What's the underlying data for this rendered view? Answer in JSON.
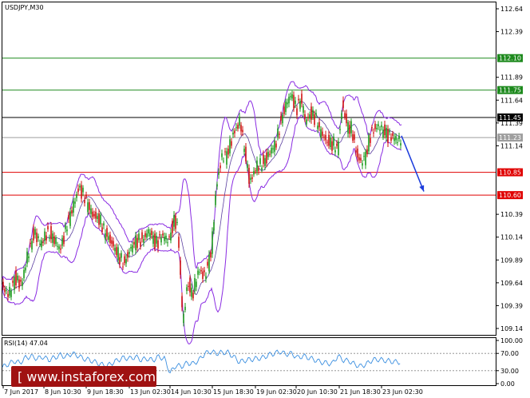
{
  "chart_data": {
    "type": "candlestick",
    "title": "USDJPY,M30",
    "price_axis": {
      "ticks": [
        112.64,
        112.39,
        111.89,
        111.64,
        111.39,
        111.14,
        110.39,
        110.14,
        109.89,
        109.64,
        109.39,
        109.14
      ],
      "ylim": [
        109.07,
        112.71
      ]
    },
    "x_labels": [
      "7 Jun 2017",
      "8 Jun 10:30",
      "9 Jun 18:30",
      "13 Jun 02:30",
      "14 Jun 10:30",
      "15 Jun 18:30",
      "19 Jun 02:30",
      "20 Jun 10:30",
      "21 Jun 18:30",
      "23 Jun 02:30"
    ],
    "levels": [
      {
        "value": 112.1,
        "label": "112.10",
        "color": "#1e8a1e"
      },
      {
        "value": 111.75,
        "label": "111.75",
        "color": "#1e8a1e"
      },
      {
        "value": 111.45,
        "label": "111.45",
        "color": "#000000"
      },
      {
        "value": 111.23,
        "label": "111.23",
        "color": "#9e9e9e"
      },
      {
        "value": 110.85,
        "label": "110.85",
        "color": "#e00000"
      },
      {
        "value": 110.6,
        "label": "110.60",
        "color": "#e00000"
      }
    ],
    "close_path": [
      [
        0,
        109.6
      ],
      [
        8,
        109.5
      ],
      [
        16,
        109.7
      ],
      [
        24,
        109.62
      ],
      [
        32,
        109.95
      ],
      [
        40,
        110.2
      ],
      [
        48,
        110.05
      ],
      [
        56,
        110.2
      ],
      [
        64,
        110.12
      ],
      [
        72,
        110.0
      ],
      [
        80,
        110.25
      ],
      [
        88,
        110.45
      ],
      [
        96,
        110.7
      ],
      [
        104,
        110.55
      ],
      [
        112,
        110.4
      ],
      [
        120,
        110.35
      ],
      [
        128,
        110.2
      ],
      [
        136,
        110.1
      ],
      [
        144,
        109.95
      ],
      [
        152,
        109.85
      ],
      [
        160,
        110.0
      ],
      [
        168,
        110.1
      ],
      [
        176,
        110.12
      ],
      [
        184,
        110.2
      ],
      [
        192,
        110.08
      ],
      [
        200,
        110.15
      ],
      [
        208,
        110.1
      ],
      [
        216,
        110.35
      ],
      [
        220,
        110.2
      ],
      [
        226,
        109.2
      ],
      [
        232,
        109.65
      ],
      [
        238,
        109.5
      ],
      [
        246,
        109.78
      ],
      [
        254,
        109.72
      ],
      [
        262,
        110.0
      ],
      [
        268,
        110.7
      ],
      [
        274,
        111.0
      ],
      [
        282,
        111.05
      ],
      [
        290,
        111.3
      ],
      [
        298,
        111.4
      ],
      [
        304,
        111.05
      ],
      [
        310,
        110.75
      ],
      [
        318,
        110.9
      ],
      [
        326,
        110.95
      ],
      [
        334,
        111.05
      ],
      [
        342,
        111.15
      ],
      [
        350,
        111.45
      ],
      [
        356,
        111.6
      ],
      [
        362,
        111.7
      ],
      [
        368,
        111.55
      ],
      [
        374,
        111.65
      ],
      [
        380,
        111.4
      ],
      [
        386,
        111.5
      ],
      [
        392,
        111.45
      ],
      [
        398,
        111.3
      ],
      [
        406,
        111.2
      ],
      [
        414,
        111.15
      ],
      [
        420,
        111.1
      ],
      [
        426,
        111.6
      ],
      [
        432,
        111.35
      ],
      [
        438,
        111.3
      ],
      [
        444,
        111.05
      ],
      [
        450,
        110.95
      ],
      [
        456,
        111.05
      ],
      [
        462,
        111.3
      ],
      [
        470,
        111.35
      ],
      [
        478,
        111.3
      ],
      [
        486,
        111.25
      ],
      [
        494,
        111.2
      ],
      [
        500,
        111.2
      ]
    ],
    "projection": {
      "from": [
        500,
        111.25
      ],
      "to": [
        528,
        110.64
      ]
    },
    "rsi": {
      "title": "RSI(14) 47.04",
      "ticks": [
        100.0,
        70.0,
        30.0,
        0.0
      ],
      "levels": [
        70,
        30
      ],
      "values": [
        38,
        45,
        52,
        48,
        60,
        63,
        58,
        62,
        55,
        60,
        66,
        62,
        70,
        65,
        58,
        55,
        50,
        45,
        40,
        48,
        55,
        60,
        58,
        62,
        55,
        58,
        54,
        62,
        58,
        25,
        42,
        40,
        48,
        46,
        55,
        70,
        74,
        70,
        72,
        72,
        62,
        50,
        54,
        56,
        58,
        60,
        66,
        70,
        74,
        68,
        70,
        60,
        64,
        60,
        55,
        50,
        48,
        46,
        64,
        54,
        52,
        44,
        40,
        46,
        55,
        56,
        54,
        52,
        50,
        50
      ]
    }
  },
  "watermark": {
    "text": "[ www.instaforex.com ]"
  }
}
